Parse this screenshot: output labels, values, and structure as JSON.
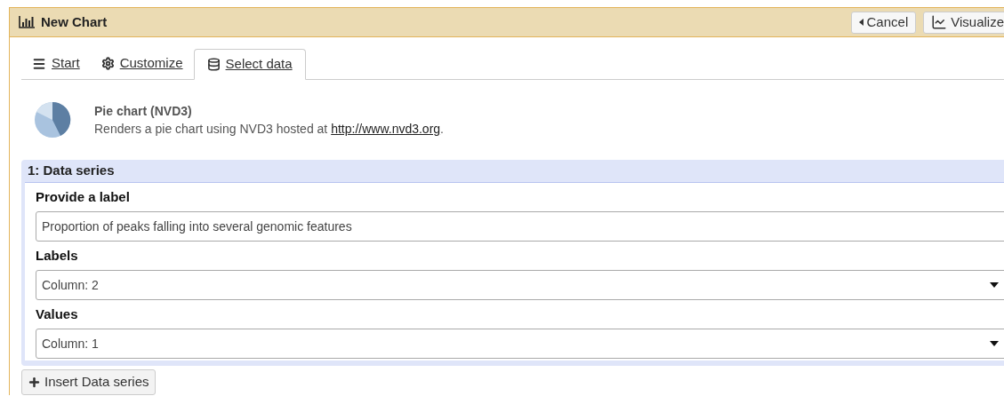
{
  "window": {
    "title": "New Chart"
  },
  "header_buttons": [
    {
      "kind": "back",
      "label": "Cancel"
    },
    {
      "kind": "visualize",
      "label": "Visualize"
    }
  ],
  "tabs": [
    {
      "kind": "list",
      "label": "Start",
      "selected": false
    },
    {
      "kind": "gear",
      "label": "Customize",
      "selected": false
    },
    {
      "kind": "database",
      "label": "Select data",
      "selected": true
    }
  ],
  "plugin": {
    "title": "Pie chart (NVD3)",
    "description": "Renders a pie chart using NVD3 hosted at ",
    "link": "http://www.nvd3.org",
    "after_link": "."
  },
  "series": {
    "title": "1: Data series",
    "fields": [
      {
        "kind": "text",
        "label": "Provide a label",
        "value": "Proportion of peaks falling into several genomic features"
      },
      {
        "kind": "select",
        "label": "Labels",
        "value": "Column: 2"
      },
      {
        "kind": "select",
        "label": "Values",
        "value": "Column: 1"
      }
    ]
  },
  "insert_button": {
    "label": "Insert Data series"
  }
}
